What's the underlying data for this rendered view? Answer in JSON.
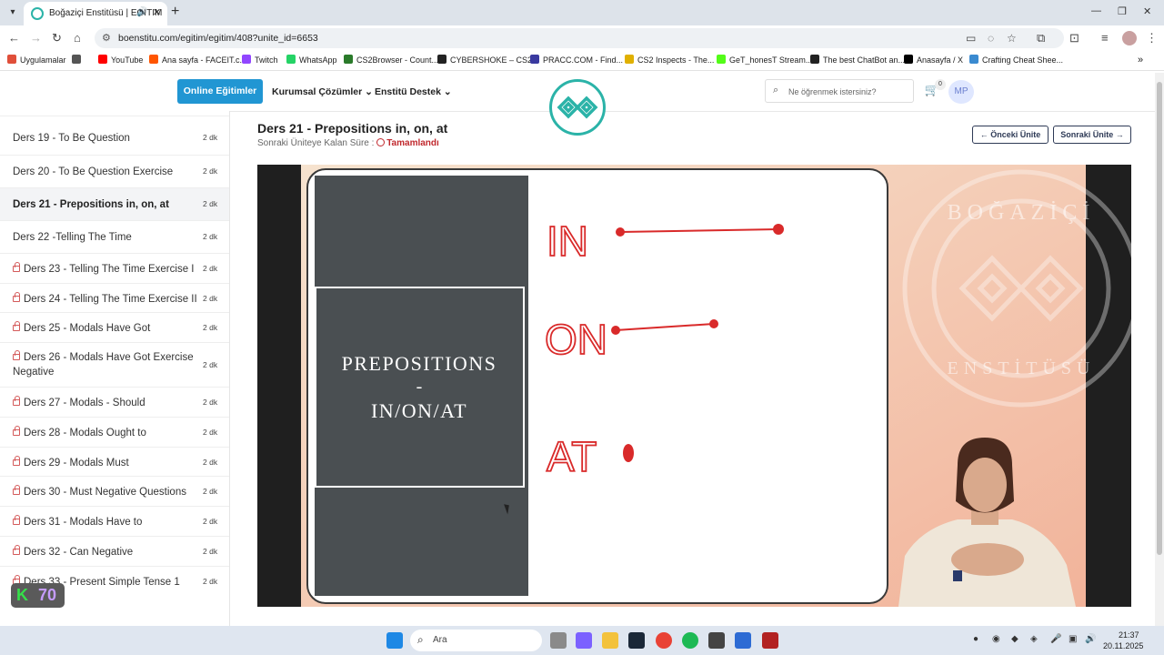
{
  "browser": {
    "tab_title": "Boğaziçi Enstitüsü | EGITIM",
    "url": "boenstitu.com/egitim/egitim/408?unite_id=6653",
    "bookmarks": [
      {
        "label": "Uygulamalar",
        "icon": "apps-grid-icon",
        "color": "#e04f3a"
      },
      {
        "label": "YouTube",
        "icon": "youtube-icon",
        "color": "#ff0000"
      },
      {
        "label": "Ana sayfa - FACEIT.c...",
        "icon": "faceit-icon",
        "color": "#ff5500"
      },
      {
        "label": "Twitch",
        "icon": "twitch-icon",
        "color": "#9146ff"
      },
      {
        "label": "WhatsApp",
        "icon": "whatsapp-icon",
        "color": "#25d366"
      },
      {
        "label": "CS2Browser - Count...",
        "icon": "cs2browser-icon",
        "color": "#2a7a2a"
      },
      {
        "label": "CYBERSHOKE – CS2...",
        "icon": "cybershoke-icon",
        "color": "#222222"
      },
      {
        "label": "PRACC.COM - Find...",
        "icon": "pracc-icon",
        "color": "#3a3aa0"
      },
      {
        "label": "CS2 Inspects - The...",
        "icon": "cs2inspects-icon",
        "color": "#e0b000"
      },
      {
        "label": "GeT_honesT Stream...",
        "icon": "kick-icon",
        "color": "#53fc18"
      },
      {
        "label": "The best ChatBot an...",
        "icon": "chatgpt-icon",
        "color": "#222222"
      },
      {
        "label": "Anasayfa / X",
        "icon": "x-icon",
        "color": "#000000"
      },
      {
        "label": "Crafting Cheat Shee...",
        "icon": "crafting-icon",
        "color": "#3a8ad0"
      }
    ]
  },
  "header": {
    "online_label": "Online Eğitimler",
    "nav_corporate": "Kurumsal Çözümler",
    "nav_support": "Enstitü Destek",
    "search_placeholder": "Ne öğrenmek istersiniz?",
    "cart_count": "0",
    "avatar_initials": "MP"
  },
  "sidebar": {
    "lessons": [
      {
        "title": "Ders 19 - To Be Question",
        "duration": "2 dk",
        "locked": false,
        "active": false
      },
      {
        "title": "Ders 20 - To Be Question Exercise",
        "duration": "2 dk",
        "locked": false,
        "active": false
      },
      {
        "title": "Ders 21 - Prepositions in, on, at",
        "duration": "2 dk",
        "locked": false,
        "active": true
      },
      {
        "title": "Ders 22 -Telling The Time",
        "duration": "2 dk",
        "locked": false,
        "active": false
      },
      {
        "title": "Ders 23 - Telling The Time Exercise I",
        "duration": "2 dk",
        "locked": true,
        "active": false
      },
      {
        "title": "Ders 24 - Telling The Time Exercise II",
        "duration": "2 dk",
        "locked": true,
        "active": false
      },
      {
        "title": "Ders 25 - Modals Have Got",
        "duration": "2 dk",
        "locked": true,
        "active": false
      },
      {
        "title": "Ders 26 - Modals Have Got Exercise Negative",
        "duration": "2 dk",
        "locked": true,
        "active": false
      },
      {
        "title": "Ders 27 - Modals - Should",
        "duration": "2 dk",
        "locked": true,
        "active": false
      },
      {
        "title": "Ders 28 - Modals Ought to",
        "duration": "2 dk",
        "locked": true,
        "active": false
      },
      {
        "title": "Ders 29 - Modals Must",
        "duration": "2 dk",
        "locked": true,
        "active": false
      },
      {
        "title": "Ders 30 - Must Negative Questions",
        "duration": "2 dk",
        "locked": true,
        "active": false
      },
      {
        "title": "Ders 31 - Modals Have to",
        "duration": "2 dk",
        "locked": true,
        "active": false
      },
      {
        "title": "Ders 32 - Can Negative",
        "duration": "2 dk",
        "locked": true,
        "active": false
      },
      {
        "title": "Ders 33 - Present Simple Tense 1",
        "duration": "2 dk",
        "locked": true,
        "active": false
      }
    ],
    "badge_letter": "K",
    "badge_value": "70"
  },
  "main": {
    "title": "Ders 21 - Prepositions in, on, at",
    "remaining_label": "Sonraki Üniteye Kalan Süre :",
    "remaining_status": "Tamamlandı",
    "prev_unit": "Önceki Ünite",
    "next_unit": "Sonraki Ünite"
  },
  "video": {
    "slide_title_line1": "PREPOSITIONS",
    "slide_title_line2": "-",
    "slide_title_line3": "IN/ON/AT",
    "label_in": "IN",
    "label_on": "ON",
    "label_at": "AT",
    "watermark_top": "BOĞAZİÇİ",
    "watermark_bottom": "ENSTİTÜSÜ"
  },
  "taskbar": {
    "search_placeholder": "Ara",
    "time": "21:37",
    "date": "20.11.2025"
  }
}
